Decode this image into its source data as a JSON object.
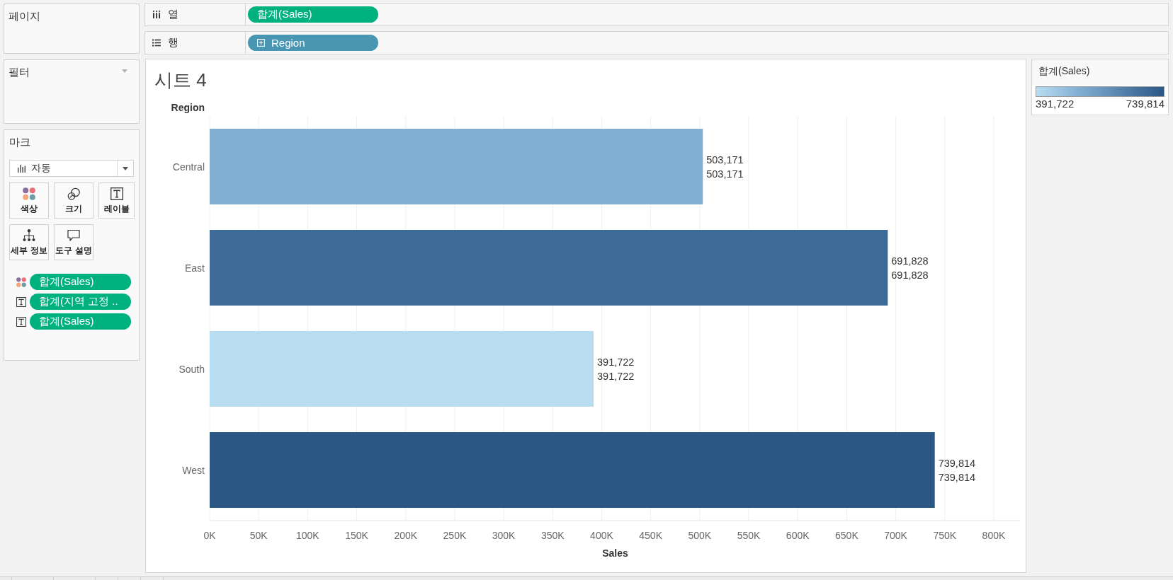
{
  "left_panel": {
    "pages_card": {
      "title": "페이지"
    },
    "filters_card": {
      "title": "필터"
    },
    "marks_card": {
      "title": "마크",
      "mark_type": "자동",
      "buttons": [
        {
          "kind": "color",
          "label": "색상"
        },
        {
          "kind": "size",
          "label": "크기"
        },
        {
          "kind": "label",
          "label": "레이블"
        },
        {
          "kind": "detail",
          "label": "세부 정보"
        },
        {
          "kind": "tooltip",
          "label": "도구 설명"
        }
      ],
      "fields": [
        {
          "kind": "color",
          "label": "합계(Sales)"
        },
        {
          "kind": "label",
          "label": "합계(지역 고정 .."
        },
        {
          "kind": "label",
          "label": "합계(Sales)"
        }
      ]
    }
  },
  "shelves": [
    {
      "kind": "columns",
      "label": "열",
      "pills": [
        {
          "kind": "measure",
          "label": "합계(Sales)"
        }
      ]
    },
    {
      "kind": "rows",
      "label": "행",
      "pills": [
        {
          "kind": "dimension",
          "label": "Region"
        }
      ]
    }
  ],
  "sheet": {
    "title": "시트 4",
    "chart_data": {
      "type": "bar",
      "orientation": "horizontal",
      "xlabel": "Sales",
      "ylabel": "Region",
      "categories": [
        "Central",
        "East",
        "South",
        "West"
      ],
      "series": [
        {
          "values": [
            503171,
            691828,
            391722,
            739814
          ]
        }
      ],
      "xlim": [
        0,
        827500
      ],
      "xticks": [
        {
          "value": 0,
          "label": "0K"
        },
        {
          "value": 50000,
          "label": "50K"
        },
        {
          "value": 100000,
          "label": "100K"
        },
        {
          "value": 150000,
          "label": "150K"
        },
        {
          "value": 200000,
          "label": "200K"
        },
        {
          "value": 250000,
          "label": "250K"
        },
        {
          "value": 300000,
          "label": "300K"
        },
        {
          "value": 350000,
          "label": "350K"
        },
        {
          "value": 400000,
          "label": "400K"
        },
        {
          "value": 450000,
          "label": "450K"
        },
        {
          "value": 500000,
          "label": "500K"
        },
        {
          "value": 550000,
          "label": "550K"
        },
        {
          "value": 600000,
          "label": "600K"
        },
        {
          "value": 650000,
          "label": "650K"
        },
        {
          "value": 700000,
          "label": "700K"
        },
        {
          "value": 750000,
          "label": "750K"
        },
        {
          "value": 800000,
          "label": "800K"
        }
      ],
      "grid": true,
      "value_labels": [
        [
          "503,171",
          "503,171"
        ],
        [
          "691,828",
          "691,828"
        ],
        [
          "391,722",
          "391,722"
        ],
        [
          "739,814",
          "739,814"
        ]
      ]
    }
  },
  "legend": {
    "title": "합계(Sales)",
    "min_label": "391,722",
    "max_label": "739,814"
  }
}
